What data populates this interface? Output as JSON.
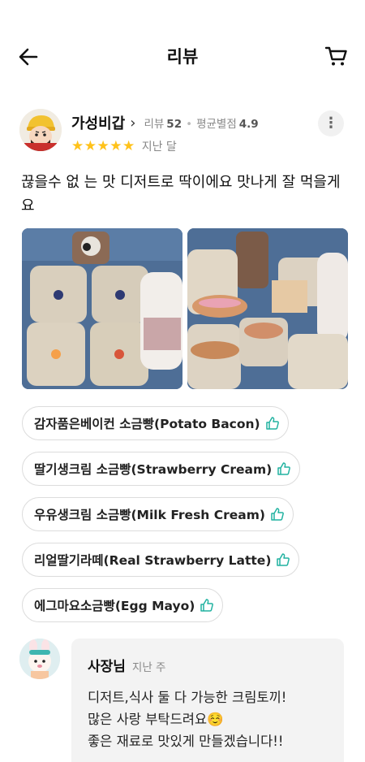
{
  "header": {
    "title": "리뷰",
    "back_icon": "arrow-left-icon",
    "cart_icon": "cart-icon"
  },
  "review": {
    "nickname": "가성비갑",
    "review_count_label": "리뷰",
    "review_count": "52",
    "avg_label": "평균별점",
    "avg_rating": "4.9",
    "stars": "★★★★★",
    "rating": 5,
    "when": "지난 달",
    "text": "끊을수 없 는 맛 디저트로 딱이에요 맛나게 잘 먹을게요",
    "star_color": "#ffc21a"
  },
  "menu_chips": [
    {
      "label": "감자품은베이컨 소금빵(Potato Bacon)"
    },
    {
      "label": "딸기생크림 소금빵(Strawberry Cream)"
    },
    {
      "label": "우유생크림 소금빵(Milk Fresh Cream)"
    },
    {
      "label": "리얼딸기라떼(Real Strawberry Latte)"
    },
    {
      "label": "에그마요소금빵(Egg Mayo)"
    }
  ],
  "owner_reply": {
    "name": "사장님",
    "when": "지난 주",
    "text": "디저트,식사 둘 다 가능한 크림토끼!\n많은 사랑 부탁드려요☺️\n좋은 재료로 맛있게 만들겠습니다!!"
  },
  "colors": {
    "thumb_accent": "#20b2a0",
    "bubble_bg": "#f3f3f3"
  }
}
